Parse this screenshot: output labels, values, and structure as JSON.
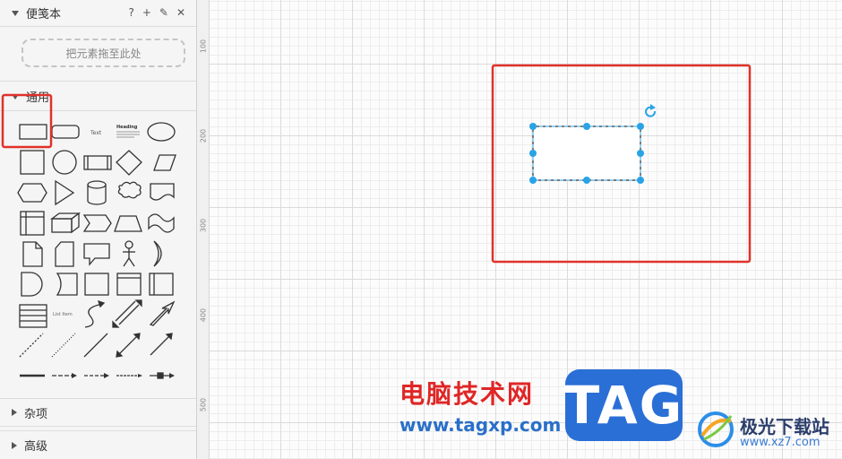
{
  "scratchpad": {
    "title": "便笺本",
    "tools": {
      "help": "?",
      "add": "+",
      "edit": "✎",
      "close": "✕"
    },
    "dropzone_label": "把元素拖至此处"
  },
  "general": {
    "title": "通用"
  },
  "misc": {
    "title": "杂项"
  },
  "advanced": {
    "title": "高级"
  },
  "palette": {
    "text_label": "Text",
    "heading_label": "Heading",
    "list_item_label": "List Item"
  },
  "ruler": {
    "marks": [
      "100",
      "200",
      "300",
      "400",
      "500"
    ]
  },
  "watermark": {
    "site_cn": "电脑技术网",
    "site_url": "www.tagxp.com",
    "tag": "TAG",
    "site2_cn": "极光下载站",
    "site2_url": "www.xz7.com"
  },
  "colors": {
    "accent": "#e0322a",
    "handle": "#29a3e6",
    "tag_blue": "#2a6fd6"
  }
}
